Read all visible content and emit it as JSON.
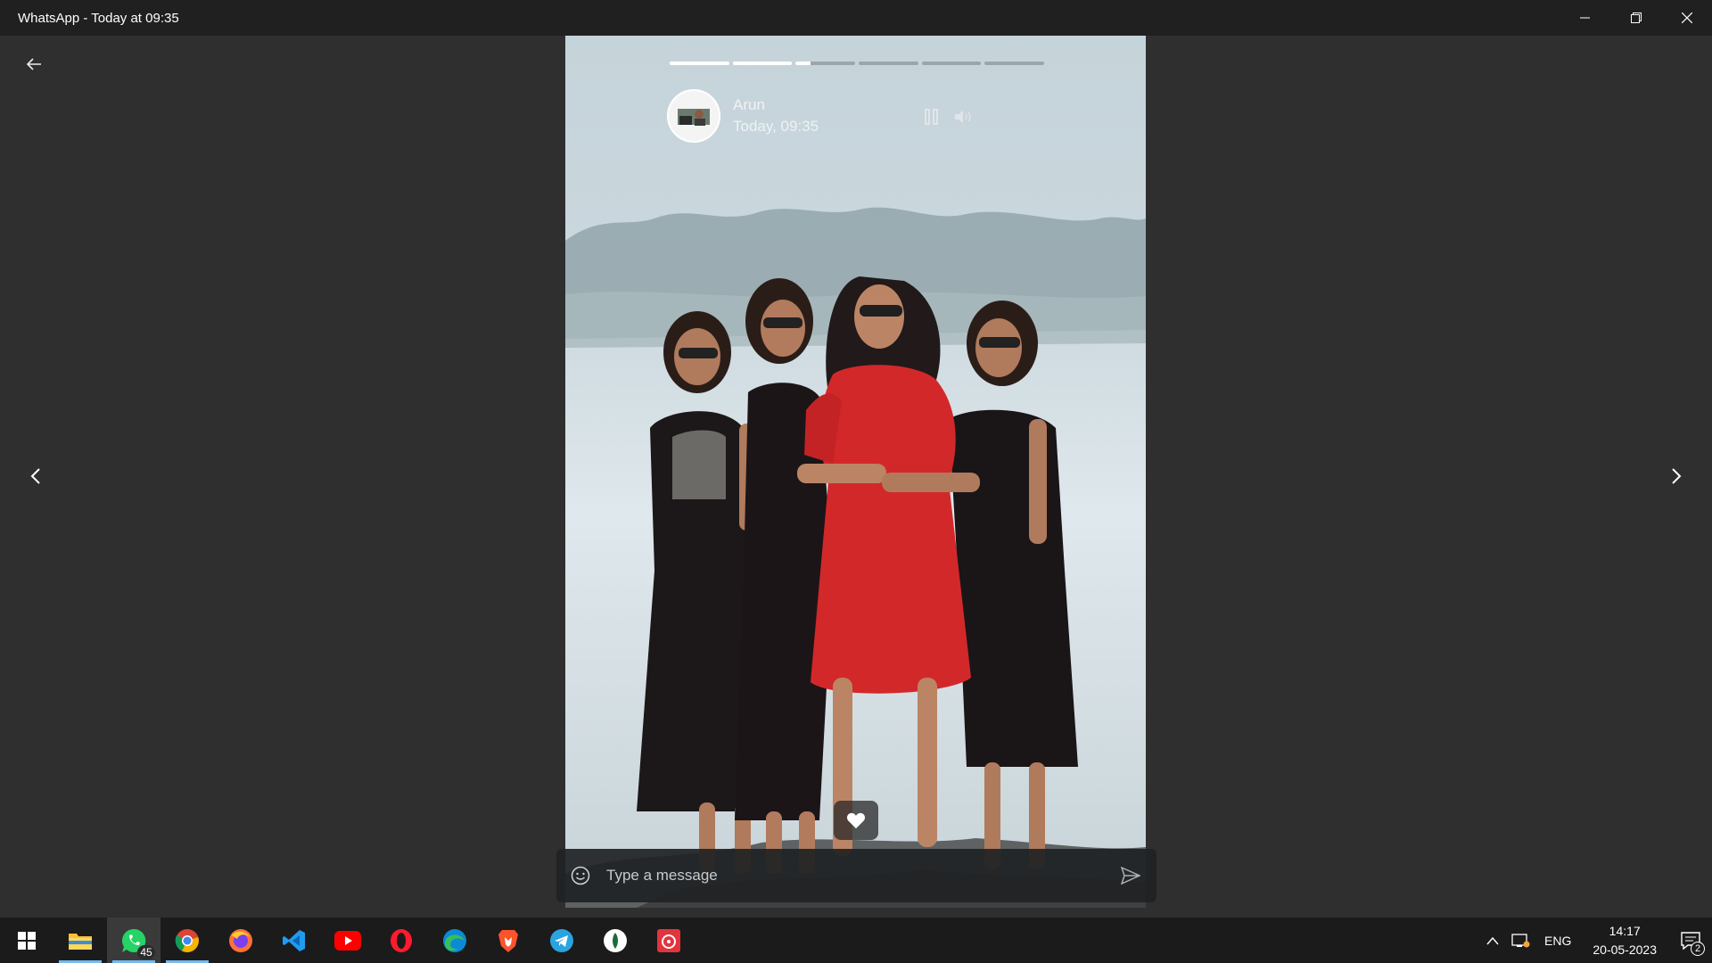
{
  "window": {
    "title": "WhatsApp - Today at 09:35"
  },
  "status": {
    "contact_name": "Arun",
    "timestamp": "Today, 09:35",
    "progress": {
      "segments_total": 6,
      "segments_fill": [
        1,
        1,
        0.25,
        0,
        0,
        0
      ]
    },
    "photo_description_icon": "status-photo"
  },
  "composer": {
    "placeholder": "Type a message"
  },
  "taskbar": {
    "apps": [
      {
        "name": "start-icon"
      },
      {
        "name": "file-explorer-icon"
      },
      {
        "name": "whatsapp-icon",
        "badge": "45",
        "active": true
      },
      {
        "name": "chrome-icon"
      },
      {
        "name": "firefox-icon"
      },
      {
        "name": "vscode-icon"
      },
      {
        "name": "youtube-icon"
      },
      {
        "name": "opera-icon"
      },
      {
        "name": "edge-icon"
      },
      {
        "name": "brave-icon"
      },
      {
        "name": "telegram-icon"
      },
      {
        "name": "app-icon"
      },
      {
        "name": "music-icon"
      }
    ],
    "tray": {
      "language": "ENG",
      "time": "14:17",
      "date": "20-05-2023",
      "notification_count": "2"
    }
  },
  "colors": {
    "accent": "#76b9ed",
    "background": "#2f2f2f",
    "dress_red": "#d3282a"
  }
}
